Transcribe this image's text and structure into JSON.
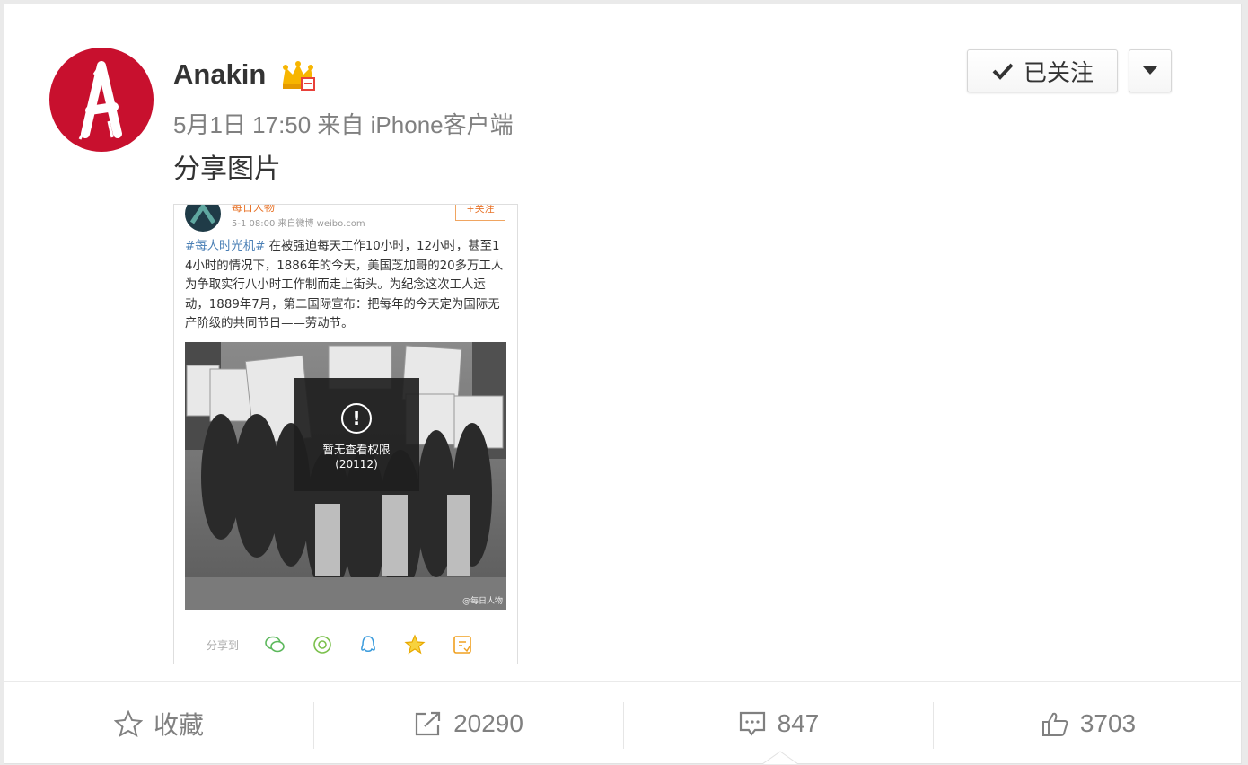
{
  "user": {
    "name": "Anakin",
    "meta": "5月1日 17:50 来自 iPhone客户端",
    "follow_label": "已关注"
  },
  "post": {
    "text": "分享图片"
  },
  "embedded": {
    "name": "每日人物",
    "meta": "5-1 08:00  来自微博 weibo.com",
    "follow": "+关注",
    "hashtag": "#每人时光机#",
    "body": " 在被强迫每天工作10小时，12小时，甚至14小时的情况下，1886年的今天，美国芝加哥的20多万工人为争取实行八小时工作制而走上街头。为纪念这次工人运动，1889年7月，第二国际宣布：把每年的今天定为国际无产阶级的共同节日——劳动节。",
    "permission_line1": "暂无查看权限",
    "permission_line2": "(20112)",
    "watermark": "@每日人物",
    "share_label": "分享到",
    "share_icons": [
      "wechat-icon",
      "moments-icon",
      "qq-icon",
      "qzone-icon",
      "note-icon"
    ]
  },
  "footer": {
    "favorite": "收藏",
    "repost": "20290",
    "comment": "847",
    "like": "3703"
  },
  "colors": {
    "avatar_red": "#c8102e",
    "text_gray": "#808080",
    "link_blue": "#4a7fb5",
    "embed_orange": "#e8742a"
  }
}
